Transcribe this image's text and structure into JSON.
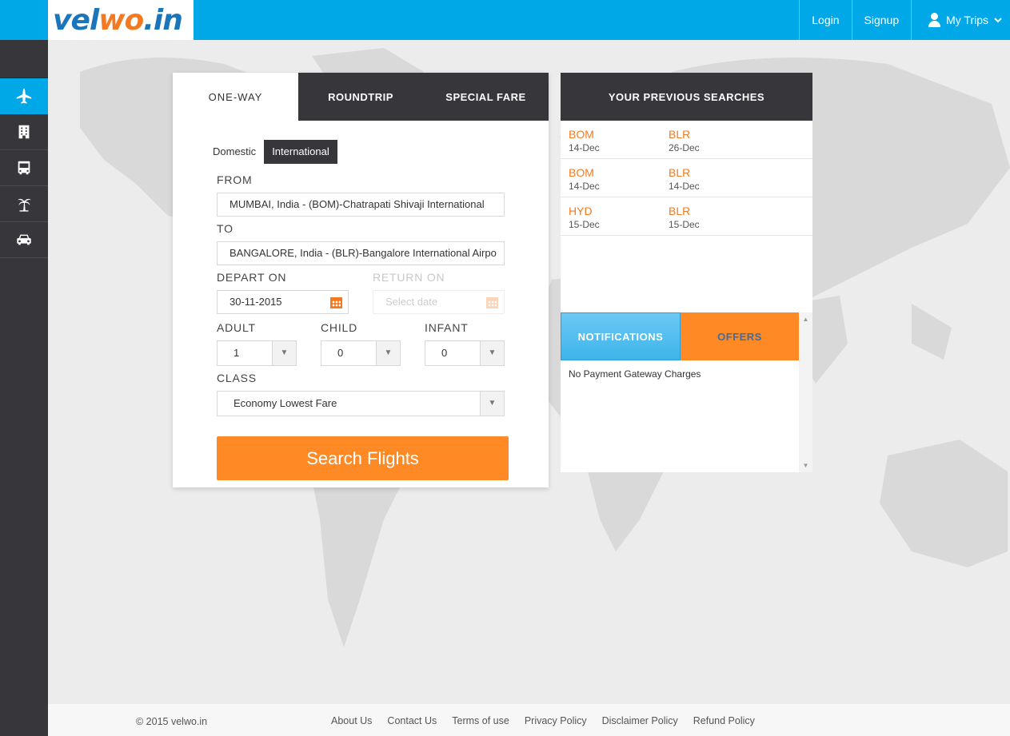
{
  "header": {
    "logo_part1": "vel",
    "logo_part2": "wo",
    "logo_part3": ".in",
    "login": "Login",
    "signup": "Signup",
    "my_trips": "My Trips"
  },
  "sidebar": {
    "items": [
      {
        "icon": "plane-icon",
        "active": true
      },
      {
        "icon": "hotel-icon",
        "active": false
      },
      {
        "icon": "bus-icon",
        "active": false
      },
      {
        "icon": "palm-tree-icon",
        "active": false
      },
      {
        "icon": "car-icon",
        "active": false
      }
    ]
  },
  "search": {
    "tabs": [
      "ONE-WAY",
      "ROUNDTRIP",
      "SPECIAL FARE"
    ],
    "domestic": "Domestic",
    "international": "International",
    "from_label": "FROM",
    "from_value": "MUMBAI, India - (BOM)-Chatrapati Shivaji International",
    "to_label": "TO",
    "to_value": "BANGALORE, India - (BLR)-Bangalore International Airpo",
    "depart_label": "DEPART ON",
    "depart_value": "30-11-2015",
    "return_label": "RETURN ON",
    "return_placeholder": "Select date",
    "adult_label": "ADULT",
    "adult_value": "1",
    "child_label": "CHILD",
    "child_value": "0",
    "infant_label": "INFANT",
    "infant_value": "0",
    "class_label": "CLASS",
    "class_value": "Economy Lowest Fare",
    "button": "Search Flights"
  },
  "previous": {
    "title": "YOUR PREVIOUS SEARCHES",
    "rows": [
      {
        "from": "BOM",
        "from_date": "14-Dec",
        "to": "BLR",
        "to_date": "26-Dec"
      },
      {
        "from": "BOM",
        "from_date": "14-Dec",
        "to": "BLR",
        "to_date": "14-Dec"
      },
      {
        "from": "HYD",
        "from_date": "15-Dec",
        "to": "BLR",
        "to_date": "15-Dec"
      }
    ]
  },
  "notifications": {
    "tab1": "NOTIFICATIONS",
    "tab2": "OFFERS",
    "text": "No Payment Gateway Charges"
  },
  "footer": {
    "copyright": "© 2015 velwo.in",
    "links": [
      "About Us",
      "Contact Us",
      "Terms of use",
      "Privacy Policy",
      "Disclaimer Policy",
      "Refund Policy"
    ]
  },
  "colors": {
    "accent_blue": "#00a8e8",
    "accent_orange": "#ff8a25",
    "dark": "#36363b"
  }
}
